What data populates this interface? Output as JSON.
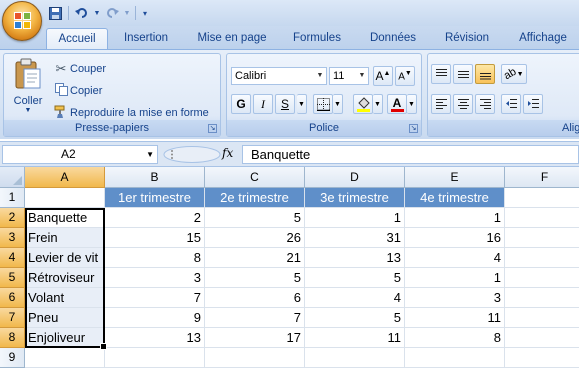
{
  "qat": {
    "save_icon": "save-icon",
    "undo_icon": "undo-icon",
    "redo_icon": "redo-icon",
    "customize_icon": "chevron-down-icon"
  },
  "tabs": [
    "Accueil",
    "Insertion",
    "Mise en page",
    "Formules",
    "Données",
    "Révision",
    "Affichage"
  ],
  "ribbon": {
    "clipboard": {
      "label": "Presse-papiers",
      "paste": "Coller",
      "cut": "Couper",
      "copy": "Copier",
      "format_painter": "Reproduire la mise en forme"
    },
    "font": {
      "label": "Police",
      "font_name": "Calibri",
      "font_size": "11",
      "bold": "G",
      "italic": "I",
      "underline": "S"
    },
    "alignment": {
      "label": "Alig"
    }
  },
  "formula_bar": {
    "name_box": "A2",
    "fx": "fx",
    "content": "Banquette"
  },
  "sheet": {
    "columns": [
      "A",
      "B",
      "C",
      "D",
      "E",
      "F"
    ],
    "rows": [
      "1",
      "2",
      "3",
      "4",
      "5",
      "6",
      "7",
      "8",
      "9"
    ],
    "headers": [
      "1er trimestre",
      "2e trimestre",
      "3e trimestre",
      "4e trimestre"
    ],
    "data": [
      {
        "label": "Banquette",
        "values": [
          "2",
          "5",
          "1",
          "1"
        ]
      },
      {
        "label": "Frein",
        "values": [
          "15",
          "26",
          "31",
          "16"
        ]
      },
      {
        "label": "Levier de vit",
        "values": [
          "8",
          "21",
          "13",
          "4"
        ]
      },
      {
        "label": "Rétroviseur",
        "values": [
          "3",
          "5",
          "5",
          "1"
        ]
      },
      {
        "label": "Volant",
        "values": [
          "7",
          "6",
          "4",
          "3"
        ]
      },
      {
        "label": "Pneu",
        "values": [
          "9",
          "7",
          "5",
          "11"
        ]
      },
      {
        "label": "Enjoliveur",
        "values": [
          "13",
          "17",
          "11",
          "8"
        ]
      }
    ]
  },
  "colors": {
    "header_fill": "#5f8fc9",
    "selection_border": "#000000",
    "selected_header": "#f1b84c"
  }
}
